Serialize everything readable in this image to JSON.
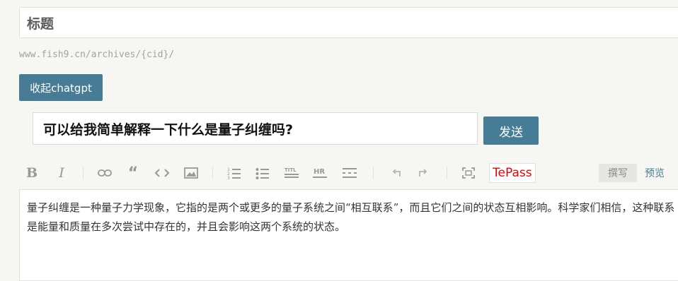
{
  "title_field": {
    "placeholder": "标题"
  },
  "url_hint": "www.fish9.cn/archives/{cid}/",
  "chatgpt_toggle_label": "收起chatgpt",
  "chatgpt": {
    "question_value": "可以给我简单解释一下什么是量子纠缠吗?",
    "send_label": "发送"
  },
  "toolbar": {
    "bold_label": "B",
    "italic_label": "I",
    "tepass_label": "TePass",
    "write_label": "撰写",
    "preview_label": "预览",
    "icons": [
      "bold-icon",
      "italic-icon",
      "link-icon",
      "quote-icon",
      "code-icon",
      "image-icon",
      "ordered-list-icon",
      "unordered-list-icon",
      "title-icon",
      "hr-icon",
      "more-icon",
      "undo-icon",
      "redo-icon",
      "fullscreen-icon"
    ]
  },
  "editor": {
    "content": "量子纠缠是一种量子力学现象，它指的是两个或更多的量子系统之间“相互联系”，而且它们之间的状态互相影响。科学家们相信，这种联系是能量和质量在多次尝试中存在的，并且会影响这两个系统的状态。"
  },
  "colors": {
    "primary": "#477c97",
    "tepass": "#ee0000",
    "background": "#f6f6f3"
  }
}
